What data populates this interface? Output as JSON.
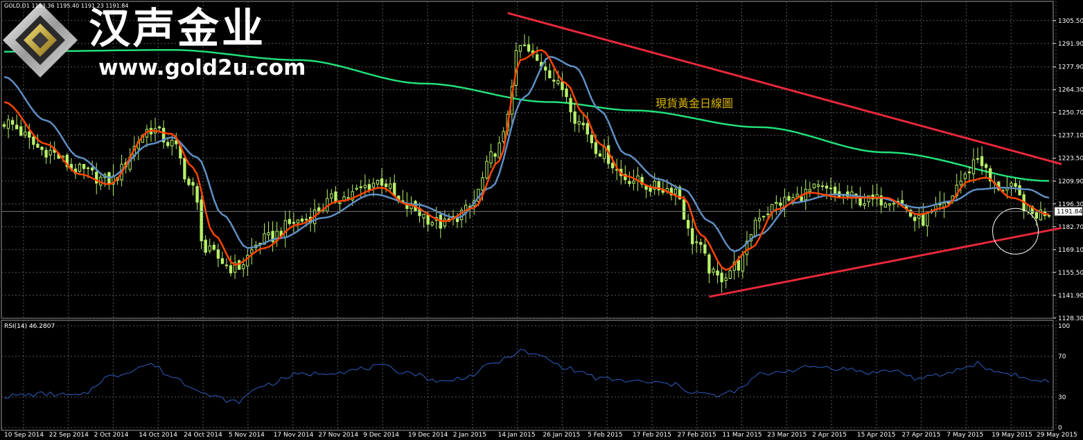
{
  "header": {
    "symbol": "GOLD,D1",
    "ohlc": "1193.36 1195.40 1191.23 1191.84"
  },
  "logo": {
    "name": "汉声金业",
    "url": "www.gold2u.com"
  },
  "colors": {
    "background": "#000000",
    "grid": "#5a5a5a",
    "axis_text": "#ffffff",
    "candle": "#b8f26a",
    "ema_fast": "#ff4500",
    "ema_slow": "#5f8fc4",
    "ma_long": "#22e07a",
    "trendline": "#e8283a",
    "rsi_line": "#2d5fc4",
    "annotation": "#d9b400"
  },
  "chart_data": [
    {
      "type": "candlestick",
      "title": "現貨黃金日線圖",
      "price_label": "1191.84",
      "ylim": [
        1128.2,
        1312.0
      ],
      "y_ticks": [
        "1305.50",
        "1291.90",
        "1277.90",
        "1264.30",
        "1250.70",
        "1237.10",
        "1223.50",
        "1209.90",
        "1196.30",
        "1182.70",
        "1169.10",
        "1155.50",
        "1141.90",
        "1128.30"
      ],
      "x_ticks": [
        "10 Sep 2014",
        "22 Sep 2014",
        "2 Oct 2014",
        "14 Oct 2014",
        "24 Oct 2014",
        "5 Nov 2014",
        "17 Nov 2014",
        "27 Nov 2014",
        "9 Dec 2014",
        "19 Dec 2014",
        "2 Jan 2015",
        "14 Jan 2015",
        "26 Jan 2015",
        "5 Feb 2015",
        "17 Feb 2015",
        "27 Feb 2015",
        "11 Mar 2015",
        "23 Mar 2015",
        "2 Apr 2015",
        "15 Apr 2015",
        "27 Apr 2015",
        "7 May 2015",
        "19 May 2015",
        "29 May 2015"
      ],
      "close_keypoints": [
        [
          0,
          1245
        ],
        [
          10,
          1228
        ],
        [
          18,
          1216
        ],
        [
          25,
          1210
        ],
        [
          35,
          1241
        ],
        [
          40,
          1232
        ],
        [
          45,
          1205
        ],
        [
          48,
          1168
        ],
        [
          55,
          1158
        ],
        [
          62,
          1175
        ],
        [
          70,
          1186
        ],
        [
          80,
          1200
        ],
        [
          90,
          1210
        ],
        [
          95,
          1195
        ],
        [
          105,
          1184
        ],
        [
          110,
          1192
        ],
        [
          118,
          1230
        ],
        [
          123,
          1290
        ],
        [
          128,
          1280
        ],
        [
          133,
          1265
        ],
        [
          137,
          1245
        ],
        [
          142,
          1228
        ],
        [
          148,
          1212
        ],
        [
          155,
          1206
        ],
        [
          160,
          1205
        ],
        [
          164,
          1175
        ],
        [
          170,
          1152
        ],
        [
          175,
          1160
        ],
        [
          180,
          1190
        ],
        [
          186,
          1198
        ],
        [
          194,
          1205
        ],
        [
          200,
          1201
        ],
        [
          206,
          1198
        ],
        [
          212,
          1200
        ],
        [
          218,
          1186
        ],
        [
          224,
          1194
        ],
        [
          228,
          1210
        ],
        [
          232,
          1224
        ],
        [
          236,
          1207
        ],
        [
          240,
          1205
        ],
        [
          245,
          1190
        ],
        [
          249,
          1191.84
        ]
      ],
      "ema_fast_keypoints": [
        [
          0,
          1257
        ],
        [
          10,
          1232
        ],
        [
          18,
          1214
        ],
        [
          25,
          1208
        ],
        [
          35,
          1240
        ],
        [
          40,
          1238
        ],
        [
          45,
          1218
        ],
        [
          50,
          1178
        ],
        [
          55,
          1160
        ],
        [
          62,
          1170
        ],
        [
          70,
          1184
        ],
        [
          80,
          1198
        ],
        [
          90,
          1206
        ],
        [
          96,
          1196
        ],
        [
          105,
          1186
        ],
        [
          112,
          1194
        ],
        [
          118,
          1222
        ],
        [
          123,
          1282
        ],
        [
          128,
          1288
        ],
        [
          134,
          1268
        ],
        [
          138,
          1250
        ],
        [
          142,
          1232
        ],
        [
          148,
          1213
        ],
        [
          155,
          1206
        ],
        [
          162,
          1200
        ],
        [
          166,
          1178
        ],
        [
          172,
          1157
        ],
        [
          178,
          1170
        ],
        [
          184,
          1193
        ],
        [
          192,
          1203
        ],
        [
          200,
          1200
        ],
        [
          210,
          1200
        ],
        [
          218,
          1190
        ],
        [
          224,
          1194
        ],
        [
          230,
          1210
        ],
        [
          234,
          1212
        ],
        [
          240,
          1200
        ],
        [
          249,
          1190
        ]
      ],
      "ema_slow_keypoints": [
        [
          0,
          1272
        ],
        [
          10,
          1246
        ],
        [
          18,
          1224
        ],
        [
          25,
          1212
        ],
        [
          35,
          1232
        ],
        [
          40,
          1236
        ],
        [
          46,
          1224
        ],
        [
          52,
          1190
        ],
        [
          58,
          1170
        ],
        [
          66,
          1176
        ],
        [
          76,
          1188
        ],
        [
          88,
          1202
        ],
        [
          98,
          1196
        ],
        [
          108,
          1188
        ],
        [
          116,
          1206
        ],
        [
          124,
          1260
        ],
        [
          130,
          1284
        ],
        [
          136,
          1278
        ],
        [
          142,
          1252
        ],
        [
          148,
          1226
        ],
        [
          156,
          1211
        ],
        [
          162,
          1205
        ],
        [
          168,
          1186
        ],
        [
          174,
          1168
        ],
        [
          180,
          1178
        ],
        [
          188,
          1197
        ],
        [
          198,
          1202
        ],
        [
          208,
          1200
        ],
        [
          218,
          1194
        ],
        [
          226,
          1198
        ],
        [
          232,
          1205
        ],
        [
          238,
          1206
        ],
        [
          244,
          1205
        ],
        [
          249,
          1200
        ]
      ],
      "ma_long_keypoints": [
        [
          0,
          1287
        ],
        [
          40,
          1288
        ],
        [
          70,
          1282
        ],
        [
          100,
          1268
        ],
        [
          130,
          1257
        ],
        [
          150,
          1252
        ],
        [
          180,
          1242
        ],
        [
          210,
          1227
        ],
        [
          249,
          1210
        ]
      ],
      "trendline_upper": [
        [
          120,
          1310
        ],
        [
          252,
          1220
        ]
      ],
      "trendline_lower": [
        [
          168,
          1141
        ],
        [
          252,
          1182
        ]
      ]
    },
    {
      "type": "line",
      "title": "RSI(14) 46.2807",
      "series": [
        {
          "name": "RSI(14)",
          "value_now": 46.2807
        }
      ],
      "ylim": [
        0,
        100
      ],
      "y_ticks": [
        "100",
        "70",
        "30",
        "0"
      ],
      "levels": [
        70,
        30
      ],
      "keypoints": [
        [
          0,
          31
        ],
        [
          10,
          33
        ],
        [
          18,
          31
        ],
        [
          25,
          50
        ],
        [
          35,
          62
        ],
        [
          40,
          50
        ],
        [
          45,
          40
        ],
        [
          50,
          30
        ],
        [
          55,
          25
        ],
        [
          62,
          42
        ],
        [
          70,
          52
        ],
        [
          80,
          55
        ],
        [
          90,
          60
        ],
        [
          95,
          55
        ],
        [
          105,
          45
        ],
        [
          110,
          50
        ],
        [
          118,
          65
        ],
        [
          123,
          75
        ],
        [
          128,
          70
        ],
        [
          133,
          60
        ],
        [
          137,
          55
        ],
        [
          142,
          48
        ],
        [
          148,
          46
        ],
        [
          155,
          44
        ],
        [
          160,
          42
        ],
        [
          164,
          35
        ],
        [
          170,
          31
        ],
        [
          175,
          37
        ],
        [
          180,
          52
        ],
        [
          186,
          56
        ],
        [
          194,
          60
        ],
        [
          200,
          58
        ],
        [
          206,
          54
        ],
        [
          212,
          56
        ],
        [
          218,
          48
        ],
        [
          224,
          52
        ],
        [
          228,
          58
        ],
        [
          232,
          63
        ],
        [
          236,
          55
        ],
        [
          240,
          53
        ],
        [
          245,
          46
        ],
        [
          249,
          46.28
        ]
      ]
    }
  ]
}
